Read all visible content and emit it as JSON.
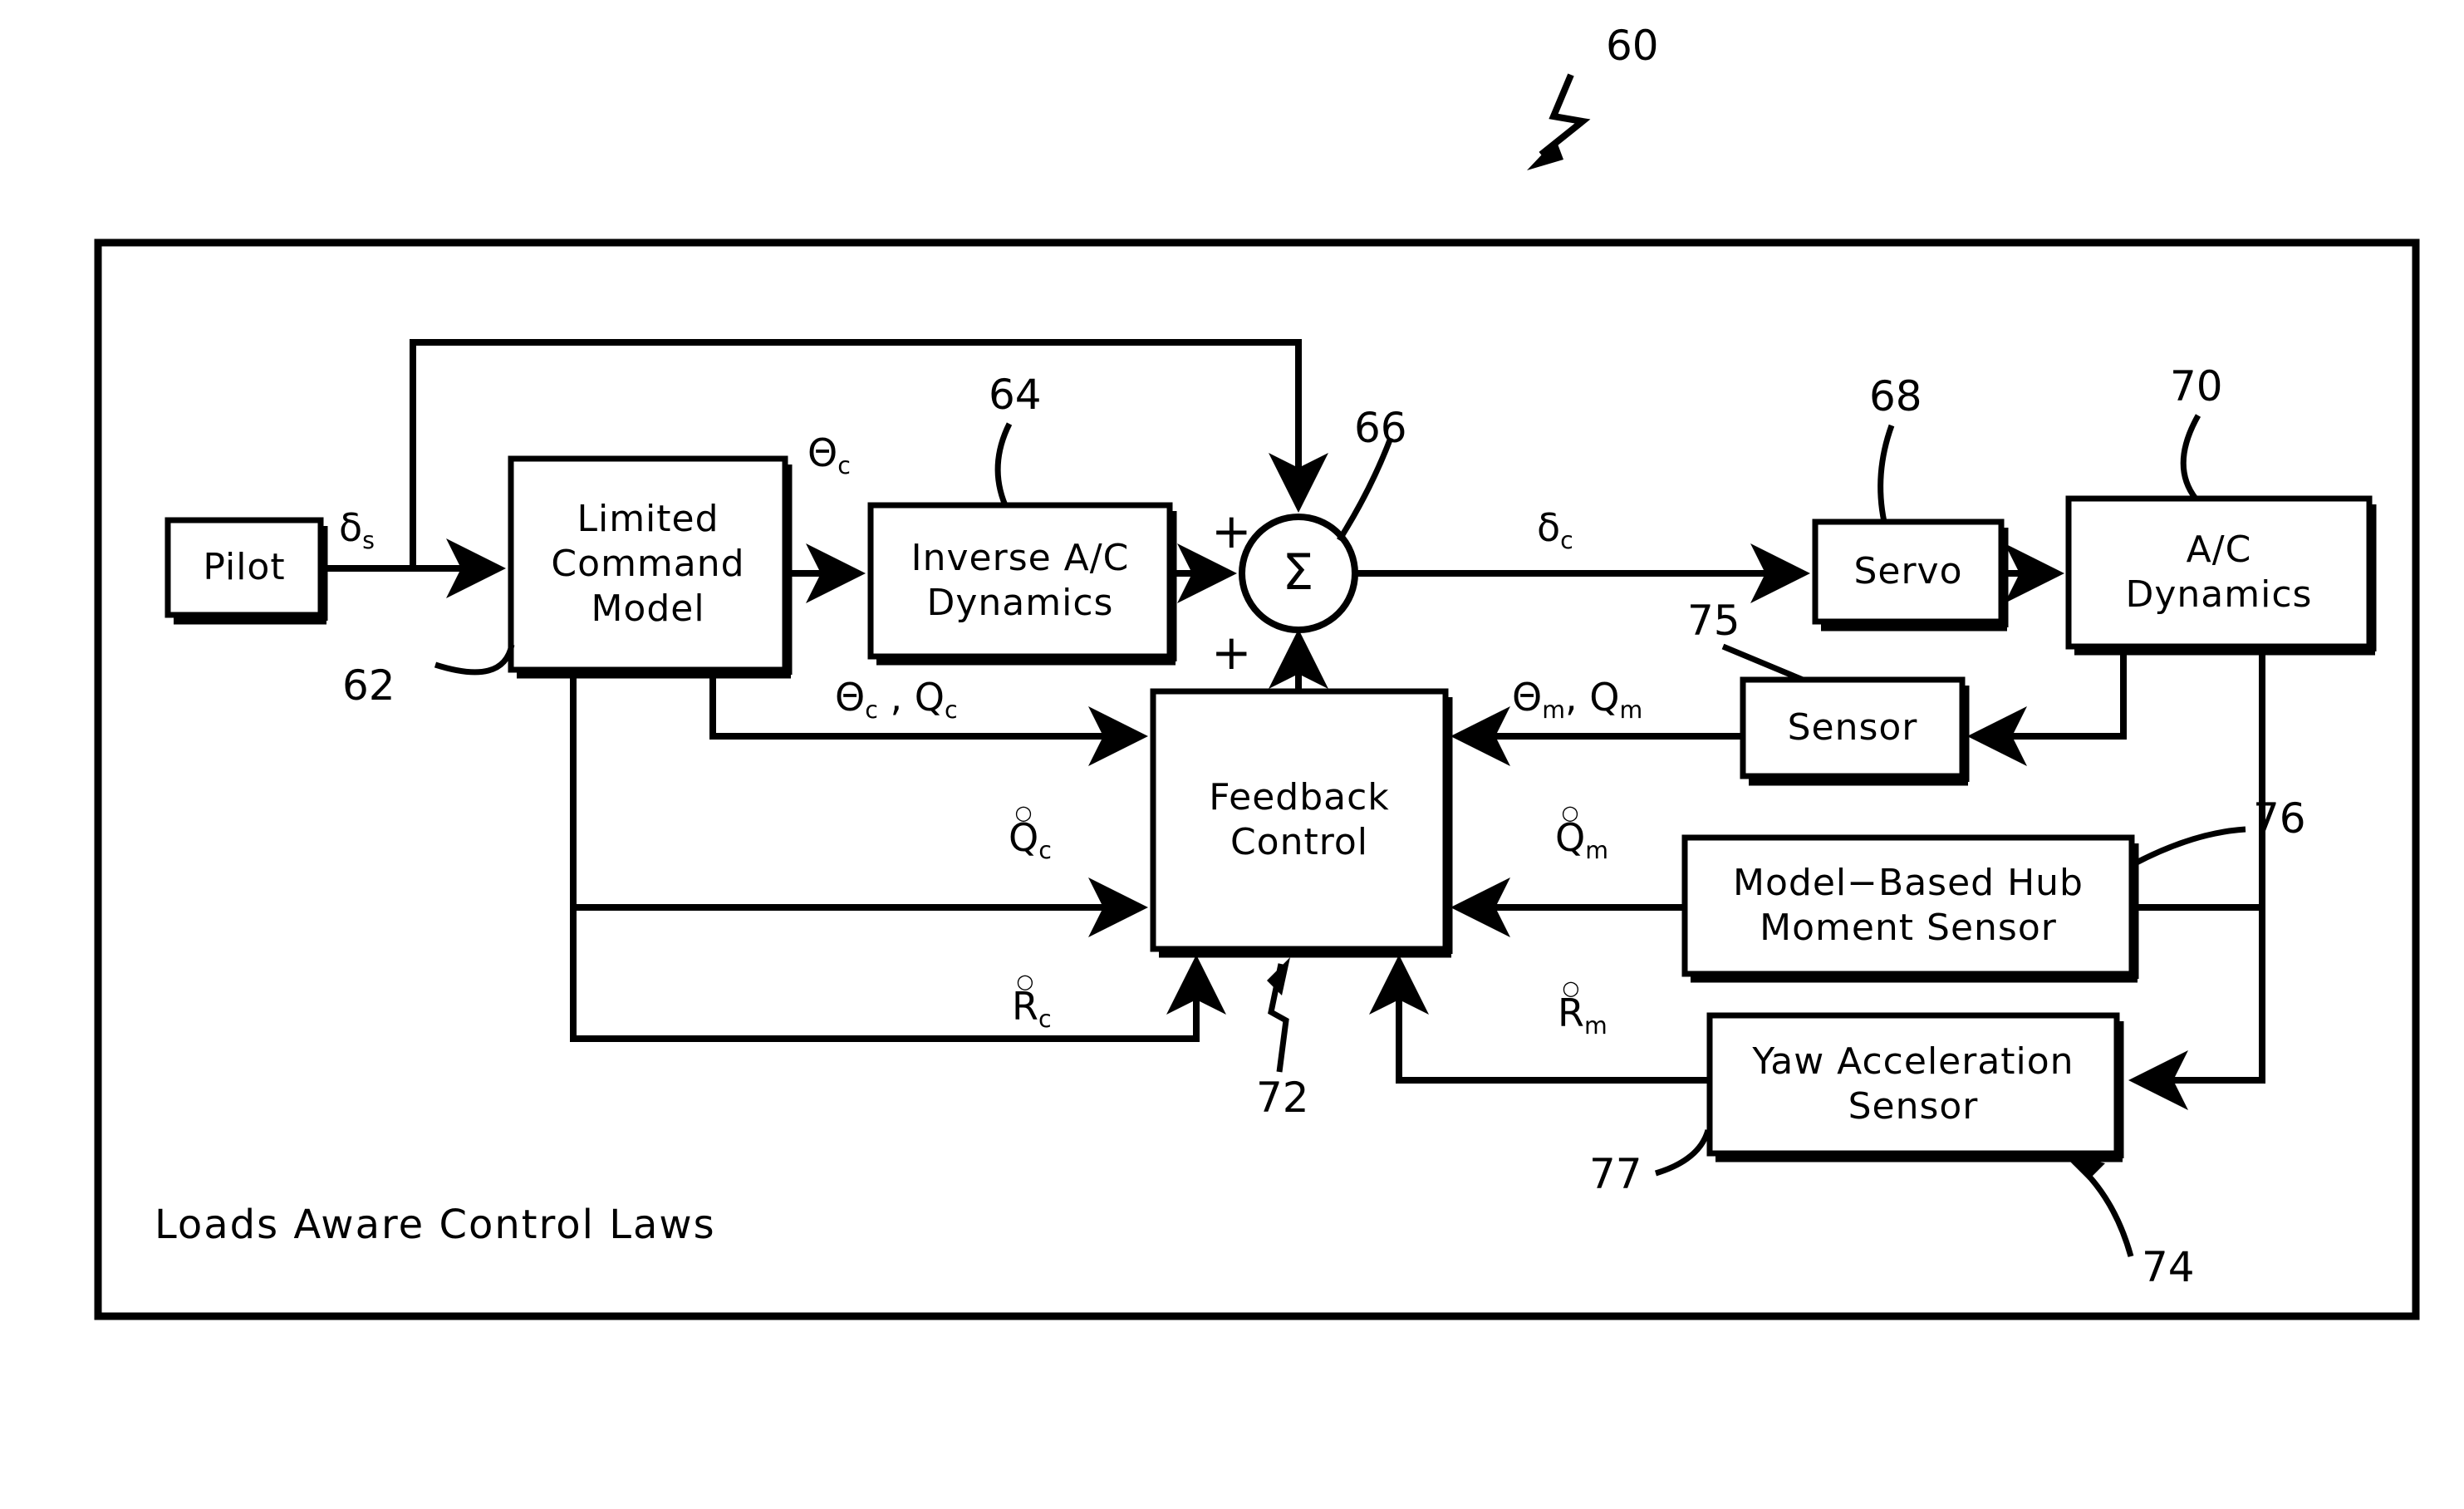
{
  "figure": {
    "reference_numeral": "60",
    "caption": "Loads  Aware  Control  Laws"
  },
  "blocks": [
    {
      "id": "pilot",
      "label": "Pilot",
      "ref": null
    },
    {
      "id": "limited_command_model",
      "label": "Limited\nCommand\nModel",
      "ref": "62"
    },
    {
      "id": "inverse_ac_dynamics",
      "label": "Inverse  A/C\nDynamics",
      "ref": "64"
    },
    {
      "id": "summing_junction",
      "label": "Σ",
      "ref": "66"
    },
    {
      "id": "servo",
      "label": "Servo",
      "ref": "68"
    },
    {
      "id": "ac_dynamics",
      "label": "A/C\nDynamics",
      "ref": "70"
    },
    {
      "id": "sensor",
      "label": "Sensor",
      "ref": "75"
    },
    {
      "id": "feedback_control",
      "label": "Feedback\nControl",
      "ref": "72"
    },
    {
      "id": "hub_moment_sensor",
      "label": "Model−Based  Hub\nMoment  Sensor",
      "ref": "76"
    },
    {
      "id": "yaw_acceleration_sensor",
      "label": "Yaw  Acceleration\nSensor",
      "ref": "77"
    }
  ],
  "reference_numerals": {
    "fig": "60",
    "lcm": "62",
    "inverse": "64",
    "sum": "66",
    "servo": "68",
    "acdyn": "70",
    "feedback": "72",
    "plant": "74",
    "sensor": "75",
    "hub": "76",
    "yaw": "77"
  },
  "signals": {
    "delta_s": {
      "base": "δ",
      "sub": "s",
      "accent": null
    },
    "theta_c_out": {
      "base": "Θ",
      "sub": "c",
      "accent": null
    },
    "delta_c": {
      "base": "δ",
      "sub": "c",
      "accent": null
    },
    "theta_q_c": {
      "text": "Θ",
      "sub1": "c",
      "sep": " , ",
      "base2": "Q",
      "sub2": "c"
    },
    "theta_q_m": {
      "text": "Θ",
      "sub1": "m",
      "sep": ", ",
      "base2": "Q",
      "sub2": "m"
    },
    "q_dot_c": {
      "base": "Q",
      "sub": "c",
      "accent": "○"
    },
    "q_dot_m": {
      "base": "Q",
      "sub": "m",
      "accent": "○"
    },
    "r_dot_c": {
      "base": "R",
      "sub": "c",
      "accent": "○"
    },
    "r_dot_m": {
      "base": "R",
      "sub": "m",
      "accent": "○"
    }
  },
  "operators": {
    "plus_top": "+",
    "plus_bottom": "+",
    "sigma": "Σ"
  },
  "colors": {
    "stroke": "#000000",
    "background": "#ffffff"
  }
}
